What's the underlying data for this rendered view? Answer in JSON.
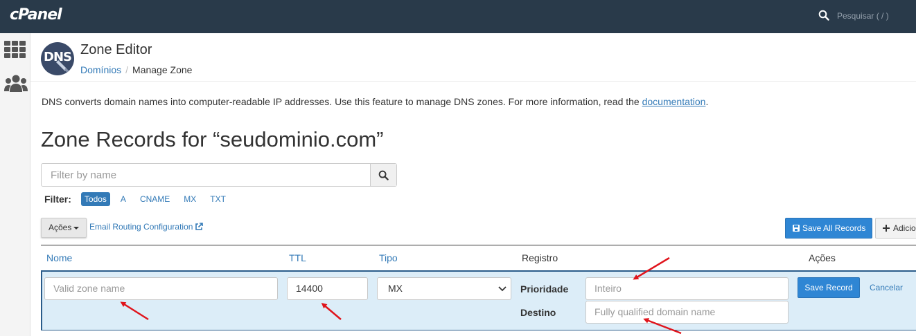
{
  "brand": {
    "logo_text": "cPanel"
  },
  "topbar": {
    "search_placeholder": "Pesquisar ( / )",
    "search_icon": "search-icon"
  },
  "sidebar": {
    "items": [
      {
        "icon": "grid-icon"
      },
      {
        "icon": "users-icon"
      }
    ]
  },
  "header": {
    "icon_text": "DNS",
    "title": "Zone Editor",
    "breadcrumb": {
      "parent": "Domínios",
      "separator": "/",
      "current": "Manage Zone"
    }
  },
  "description": {
    "text": "DNS converts domain names into computer-readable IP addresses. Use this feature to manage DNS zones. For more information, read the ",
    "link": "documentation",
    "suffix": "."
  },
  "zone_heading": "Zone Records for “seudominio.com”",
  "filter": {
    "placeholder": "Filter by name",
    "label": "Filter:",
    "options": [
      "Todos",
      "A",
      "CNAME",
      "MX",
      "TXT"
    ],
    "active": "Todos"
  },
  "toolbar": {
    "actions_label": "Ações",
    "email_routing_label": "Email Routing Configuration",
    "save_all_label": "Save All Records",
    "add_label": "Adicionar"
  },
  "table": {
    "headers": {
      "name": "Nome",
      "ttl": "TTL",
      "type": "Tipo",
      "record": "Registro",
      "actions": "Ações"
    }
  },
  "edit_row": {
    "name_placeholder": "Valid zone name",
    "ttl_value": "14400",
    "type_value": "MX",
    "priority_label": "Prioridade",
    "priority_placeholder": "Inteiro",
    "destination_label": "Destino",
    "destination_placeholder": "Fully qualified domain name",
    "save_label": "Save Record",
    "cancel_label": "Cancelar"
  },
  "colors": {
    "topbar": "#293a4a",
    "accent": "#337ab7",
    "primary_button": "#2f86d4",
    "edit_row_bg": "#dcedf8",
    "annotation_arrow": "#e0141c"
  }
}
